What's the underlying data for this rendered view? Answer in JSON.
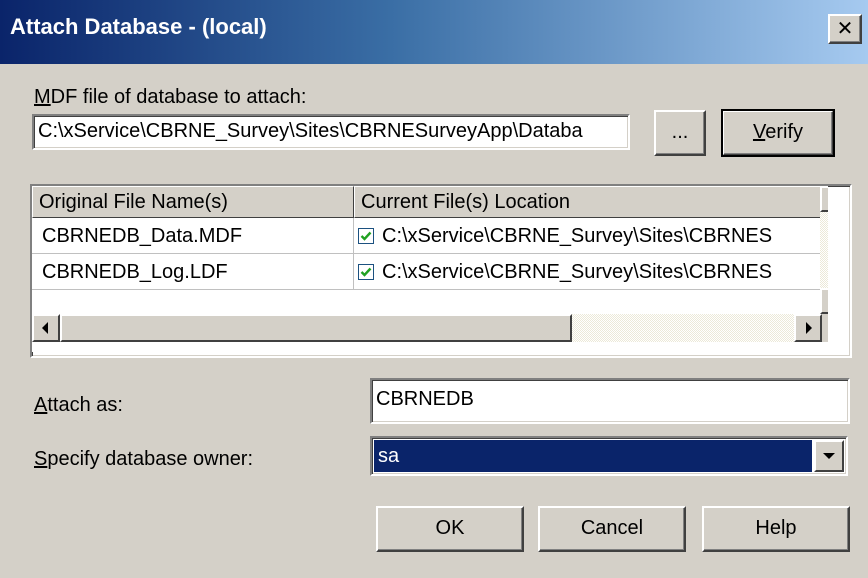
{
  "window": {
    "title": "Attach Database - (local)",
    "close_glyph": "✕"
  },
  "mdf": {
    "label_accel": "M",
    "label_rest": "DF file of database to attach:",
    "path_value": "C:\\xService\\CBRNE_Survey\\Sites\\CBRNESurveyApp\\Databa",
    "browse_label": "...",
    "verify_accel": "V",
    "verify_rest": "erify"
  },
  "files_table": {
    "columns": [
      "Original File Name(s)",
      "Current File(s) Location"
    ],
    "rows": [
      {
        "name": "CBRNEDB_Data.MDF",
        "checked": true,
        "location": "C:\\xService\\CBRNE_Survey\\Sites\\CBRNES"
      },
      {
        "name": "CBRNEDB_Log.LDF",
        "checked": true,
        "location": "C:\\xService\\CBRNE_Survey\\Sites\\CBRNES"
      }
    ]
  },
  "attach_as": {
    "label_accel": "A",
    "label_rest": "ttach as:",
    "value": "CBRNEDB"
  },
  "owner": {
    "label_accel": "S",
    "label_rest": "pecify database owner:",
    "selected": "sa"
  },
  "buttons": {
    "ok": "OK",
    "cancel": "Cancel",
    "help": "Help"
  },
  "colors": {
    "title_bar": "#0a246a",
    "dialog_bg": "#d4d0c8",
    "selection": "#0a246a",
    "check": "#21a121"
  },
  "icons": {
    "close": "close-icon",
    "check": "checkmark-icon",
    "scroll_up": "scroll-up-arrow-icon",
    "scroll_down": "scroll-down-arrow-icon",
    "scroll_left": "scroll-left-arrow-icon",
    "scroll_right": "scroll-right-arrow-icon",
    "dropdown": "dropdown-arrow-icon"
  }
}
